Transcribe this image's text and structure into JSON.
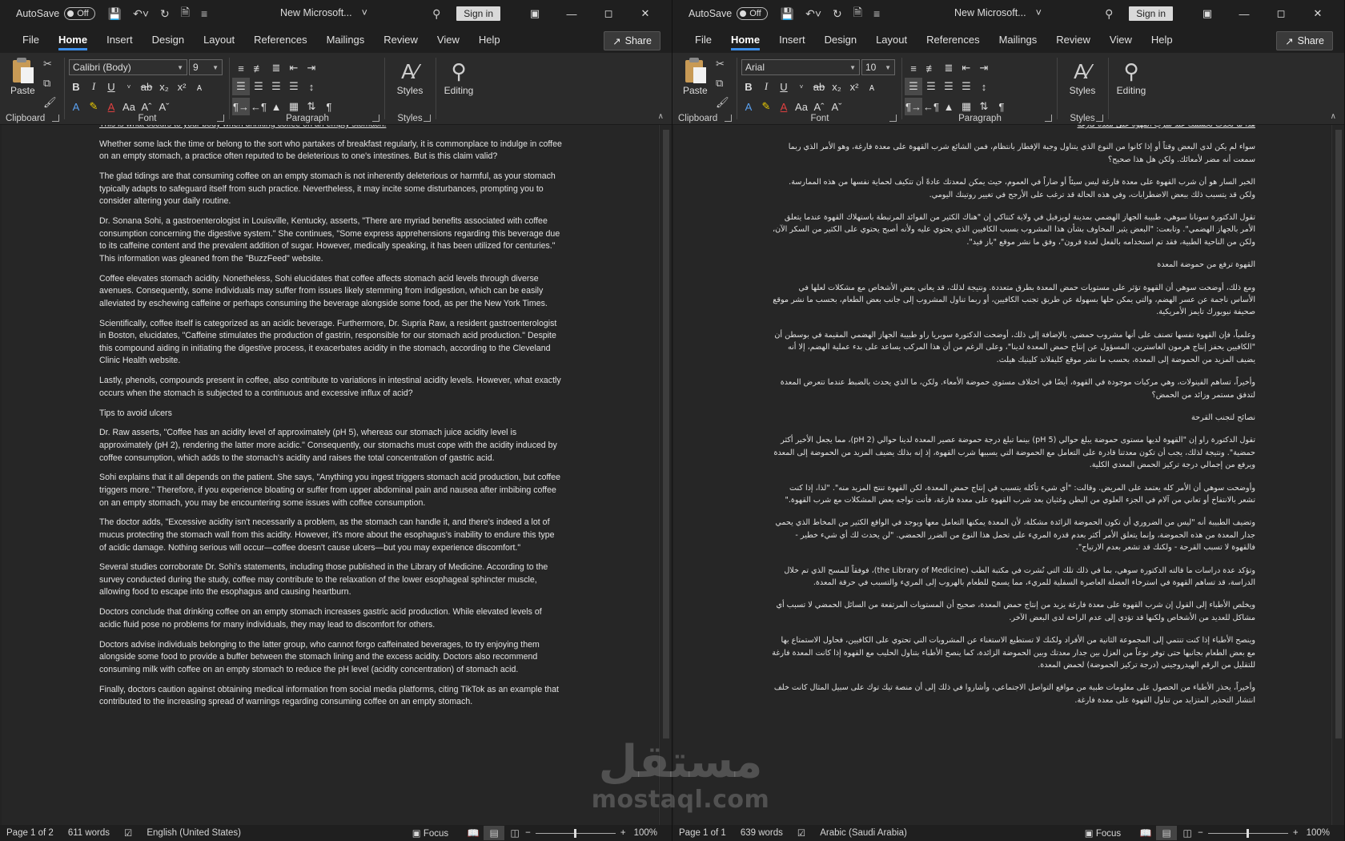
{
  "app": {
    "autosave_label": "AutoSave",
    "autosave_state": "Off",
    "signin_label": "Sign in",
    "share_label": "Share",
    "tabs": [
      "File",
      "Home",
      "Insert",
      "Design",
      "Layout",
      "References",
      "Mailings",
      "Review",
      "View",
      "Help"
    ],
    "active_tab": "Home",
    "groups": {
      "clipboard": "Clipboard",
      "font": "Font",
      "paragraph": "Paragraph",
      "styles": "Styles"
    },
    "paste_label": "Paste",
    "styles_label": "Styles",
    "editing_label": "Editing",
    "accent_color": "#3b8eea"
  },
  "left": {
    "doc_title": "New Microsoft...",
    "font_name": "Calibri (Body)",
    "font_size": "9",
    "status": {
      "page": "Page 1 of 2",
      "words": "611 words",
      "language": "English (United States)",
      "focus": "Focus",
      "zoom": "100%"
    },
    "paragraphs": [
      "This is what occurs to your body when drinking coffee on an empty stomach.",
      "Whether some lack the time or belong to the sort who partakes of breakfast regularly, it is commonplace to indulge in coffee on an empty stomach, a practice often reputed to be deleterious to one's intestines. But is this claim valid?",
      "The glad tidings are that consuming coffee on an empty stomach is not inherently deleterious or harmful, as your stomach typically adapts to safeguard itself from such practice. Nevertheless, it may incite some disturbances, prompting you to consider altering your daily routine.",
      "Dr. Sonana Sohi, a gastroenterologist in Louisville, Kentucky, asserts, \"There are myriad benefits associated with coffee consumption concerning the digestive system.\" She continues, \"Some express apprehensions regarding this beverage due to its caffeine content and the prevalent addition of sugar. However, medically speaking, it has been utilized for centuries.\" This information was gleaned from the \"BuzzFeed\" website.",
      "Coffee elevates stomach acidity. Nonetheless, Sohi elucidates that coffee affects stomach acid levels through diverse avenues. Consequently, some individuals may suffer from issues likely stemming from indigestion, which can be easily alleviated by eschewing caffeine or perhaps consuming the beverage alongside some food, as per the New York Times.",
      "Scientifically, coffee itself is categorized as an acidic beverage. Furthermore, Dr. Supria Raw, a resident gastroenterologist in Boston, elucidates, \"Caffeine stimulates the production of gastrin, responsible for our stomach acid production.\" Despite this compound aiding in initiating the digestive process, it exacerbates acidity in the stomach, according to the Cleveland Clinic Health website.",
      "Lastly, phenols, compounds present in coffee, also contribute to variations in intestinal acidity levels. However, what exactly occurs when the stomach is subjected to a continuous and excessive influx of acid?",
      "Tips to avoid ulcers",
      "Dr. Raw asserts, \"Coffee has an acidity level of approximately (pH 5), whereas our stomach juice acidity level is approximately (pH 2), rendering the latter more acidic.\" Consequently, our stomachs must cope with the acidity induced by coffee consumption, which adds to the stomach's acidity and raises the total concentration of gastric acid.",
      "Sohi explains that it all depends on the patient. She says, \"Anything you ingest triggers stomach acid production, but coffee triggers more.\" Therefore, if you experience bloating or suffer from upper abdominal pain and nausea after imbibing coffee on an empty stomach, you may be encountering some issues with coffee consumption.",
      "The doctor adds, \"Excessive acidity isn't necessarily a problem, as the stomach can handle it, and there's indeed a lot of mucus protecting the stomach wall from this acidity. However, it's more about the esophagus's inability to endure this type of acidic damage. Nothing serious will occur—coffee doesn't cause ulcers—but you may experience discomfort.\"",
      "Several studies corroborate Dr. Sohi's statements, including those published in the Library of Medicine. According to the survey conducted during the study, coffee may contribute to the relaxation of the lower esophageal sphincter muscle, allowing food to escape into the esophagus and causing heartburn.",
      "Doctors conclude that drinking coffee on an empty stomach increases gastric acid production. While elevated levels of acidic fluid pose no problems for many individuals, they may lead to discomfort for others.",
      "Doctors advise individuals belonging to the latter group, who cannot forgo caffeinated beverages, to try enjoying them alongside some food to provide a buffer between the stomach lining and the excess acidity. Doctors also recommend consuming milk with coffee on an empty stomach to reduce the pH level (acidity concentration) of stomach acid.",
      "Finally, doctors caution against obtaining medical information from social media platforms, citing TikTok as an example that contributed to the increasing spread of warnings regarding consuming coffee on an empty stomach."
    ]
  },
  "right": {
    "doc_title": "New Microsoft...",
    "font_name": "Arial",
    "font_size": "10",
    "status": {
      "page": "Page 1 of 1",
      "words": "639 words",
      "language": "Arabic (Saudi Arabia)",
      "focus": "Focus",
      "zoom": "100%"
    },
    "paragraphs": [
      "هذا ما يحدث لجسمك عند شرب القهوة على معدة فارغة",
      "سواء لم يكن لدى البعض وقتاً أو إذا كانوا من النوع الذي يتناول وجبة الإفطار بانتظام، فمن الشائع شرب القهوة على معدة فارغة، وهو الأمر الذي ربما سمعت أنه مضر لأمعائك. ولكن هل هذا صحيح؟",
      "الخبر السار هو أن شرب القهوة على معدة فارغة ليس سيئاً أو ضاراً في العموم، حيث يمكن لمعدتك عادةً أن تتكيف لحماية نفسها من هذه الممارسة. ولكن قد يتسبب ذلك ببعض الاضطرابات، وفي هذه الحالة قد ترغب على الأرجح في تغيير روتينك اليومي.",
      "تقول الدكتورة سونانا سوهي، طبيبة الجهاز الهضمي بمدينة لويزفيل في ولاية كنتاكي إن \"هناك الكثير من الفوائد المرتبطة باستهلاك القهوة عندما يتعلق الأمر بالجهاز الهضمي\". وتابعت: \"البعض يثير المخاوف بشأن هذا المشروب بسبب الكافيين الذي يحتوي عليه ولأنه أصبح يحتوي على الكثير من السكر الآن، ولكن من الناحية الطبية، فقد تم استخدامه بالفعل لعدة قرون\"، وفق ما نشر موقع \"باز فيد\".",
      "القهوة ترفع من حموضة المعدة",
      "ومع ذلك، أوضحت سوهي أن القهوة تؤثر على مستويات حمض المعدة بطرق متعددة. ونتيجة لذلك، قد يعاني بعض الأشخاص مع مشكلات لعلها في الأساس ناجمة عن عسر الهضم، والتي يمكن حلها بسهولة عن طريق تجنب الكافيين، أو ربما تناول المشروب إلى جانب بعض الطعام، بحسب ما نشر موقع صحيفة نيويورك تايمز الأمريكية.",
      "وعلمياً، فإن القهوة نفسها تصنف على أنها مشروب حمضي. بالإضافة إلى ذلك، أوضحت الدكتورة سوبريا راو طبيبة الجهاز الهضمي المقيمة في بوسطن أن \"الكافيين يحفز إنتاج هرمون الغاسترين، المسؤول عن إنتاج حمض المعدة لدينا\"، وعلى الرغم من أن هذا المركب يساعد على بدء عملية الهضم، إلا أنه يضيف المزيد من الحموضة إلى المعدة، بحسب ما نشر موقع كليفلاند كلينيك هيلث.",
      "وأخيراً، تساهم الفينولات، وهي مركبات موجودة في القهوة، أيضًا في اختلاف مستوى حموضة الأمعاء. ولكن، ما الذي يحدث بالضبط عندما تتعرض المعدة لتدفق مستمر وزائد من الحمض؟",
      "نصائح لتجنب القرحة",
      "تقول الدكتورة راو إن \"القهوة لديها مستوى حموضة يبلغ حوالي (5 pH) بينما تبلغ درجة حموضة عصير المعدة لدينا حوالي (2 pH)، مما يجعل الأخير أكثر حمضية\". ونتيجة لذلك، يجب أن تكون معدتنا قادرة على التعامل مع الحموضة التي يسببها شرب القهوة، إذ إنه بذلك يضيف المزيد من الحموضة إلى المعدة ويرفع من إجمالي درجة تركيز الحمض المعدي الكلية.",
      "وأوضحت سوهي أن الأمر كله يعتمد على المريض. وقالت: \"أي شيء تأكله يتسبب في إنتاج حمض المعدة، لكن القهوة تنتج المزيد منه\". \"لذا، إذا كنت تشعر بالانتفاخ أو تعاني من آلام في الجزء العلوي من البطن وغثيان بعد شرب القهوة على معدة فارغة، فأنت تواجه بعض المشكلات مع شرب القهوة.\"",
      "وتضيف الطبيبة أنه \"ليس من الضروري أن تكون الحموضة الزائدة مشكلة، لأن المعدة يمكنها التعامل معها ويوجد في الواقع الكثير من المخاط الذي يحمي جدار المعدة من هذه الحموضة، وإنما يتعلق الأمر أكثر بعدم قدرة المريء على تحمل هذا النوع من الضرر الحمضي. \"لن يحدث لك أي شيء خطير - فالقهوة لا تسبب القرحة - ولكنك قد تشعر بعدم الارتياح\".",
      "وتؤكد عدة دراسات ما قالته الدكتورة سوهي، بما في ذلك تلك التي نُشرت في مكتبة الطب (the Library of Medicine)، فوفقاً للمسح الذي تم خلال الدراسة، قد تساهم القهوة في استرخاء العضلة العاصرة السفلية للمريء، مما يسمح للطعام بالهروب إلى المريء والتسبب في حرقة المعدة.",
      "ويخلص الأطباء إلى القول إن شرب القهوة على معدة فارغة يزيد من إنتاج حمض المعدة، صحيح أن المستويات المرتفعة من السائل الحمضي لا تسبب أي مشاكل للعديد من الأشخاص ولكنها قد تؤدي إلى عدم الراحة لدى البعض الآخر.",
      "وينصح الأطباء إذا كنت تنتمي إلى المجموعة الثانية من الأفراد ولكنك لا تستطيع الاستغناء عن المشروبات التي تحتوي على الكافيين، فحاول الاستمتاع بها مع بعض الطعام بجانبها حتى توفر نوعاً من العزل بين جدار معدتك وبين الحموضة الزائدة، كما ينصح الأطباء بتناول الحليب مع القهوة إذا كانت المعدة فارغة للتقليل من الرقم الهيدروجيني (درجة تركيز الحموضة) لحمض المعدة.",
      "وأخيراً، يحذر الأطباء من الحصول على معلومات طبية من مواقع التواصل الاجتماعي، وأشاروا في ذلك إلى أن منصة تيك توك على سبيل المثال كانت خلف انتشار التحذير المتزايد من تناول القهوة على معدة فارغة."
    ]
  },
  "watermark": {
    "arabic": "مستقل",
    "latin": "mostaql.com"
  }
}
